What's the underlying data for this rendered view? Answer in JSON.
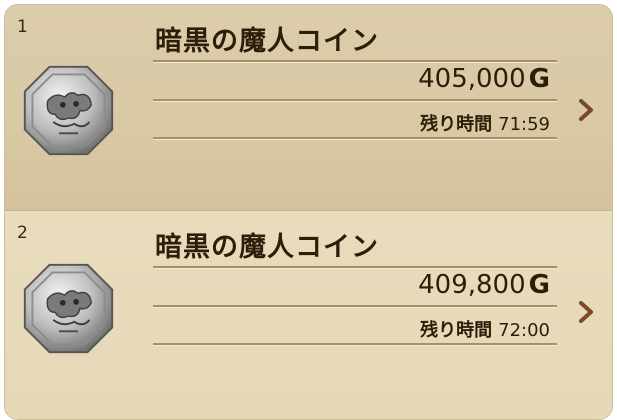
{
  "list": {
    "items": [
      {
        "rank": "1",
        "name": "暗黒の魔人コイン",
        "price": "405,000",
        "currency": "G",
        "time_label": "残り時間",
        "time_value": "71:59",
        "icon": "demon-coin-icon"
      },
      {
        "rank": "2",
        "name": "暗黒の魔人コイン",
        "price": "409,800",
        "currency": "G",
        "time_label": "残り時間",
        "time_value": "72:00",
        "icon": "demon-coin-icon"
      }
    ]
  },
  "colors": {
    "text": "#2d1e0a",
    "chevron": "#7a4a25",
    "parchment": "#e7dab9"
  }
}
